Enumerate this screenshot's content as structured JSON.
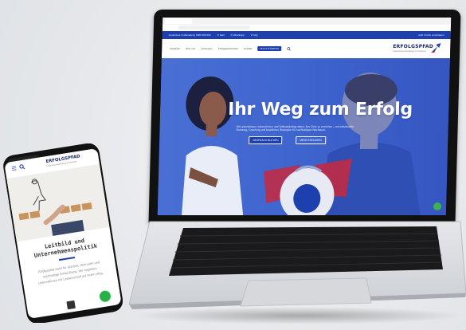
{
  "laptop": {
    "topbar": {
      "left_items": [
        "Kostenlose Erstberatung: 0800 000 000",
        "✉ Mail",
        "✆ WhatsApp",
        "⚲ FAQ"
      ],
      "right_item": "Jetzt Termin vereinbaren"
    },
    "nav": {
      "items": [
        "Startseite",
        "Über uns",
        "Leistungen",
        "Erfolgsgeschichten",
        "Kontakt"
      ],
      "cta": "JETZT STARTEN",
      "search_icon": "search-icon"
    },
    "logo": {
      "name": "ERFOLGSPFAD",
      "tagline": "Unternehmensberatung & Coaching",
      "icon": "arrow-up-right-icon"
    },
    "hero": {
      "title": "Ihr Weg zum Erfolg",
      "subtitle": "Wir unterstützen Unternehmen und Selbstständige dabei, ihre Ziele zu erreichen – mit individueller Beratung, Coaching und bewährten Strategien für nachhaltiges Wachstum.",
      "button_primary": "GESPRÄCH BUCHEN",
      "button_secondary": "MEHR ERFAHREN"
    }
  },
  "phone": {
    "logo": {
      "name": "ERFOLGSPFAD",
      "tagline": "Unternehmensberatung & Coaching"
    },
    "menu_icon": "☰",
    "heading_line1": "Leitbild und",
    "heading_line2": "Unternehmenspolitik",
    "body_text": "Erfolgspfad steht für Klarheit, Vertrauen und nachhaltige Entwicklung. Wir begleiten Unternehmen mit Leidenschaft auf ihrem Weg."
  },
  "colors": {
    "brand_blue": "#1e3fae",
    "hero_blue": "#3f65cf",
    "accent_red": "#c8283c",
    "whatsapp_green": "#25b347"
  }
}
